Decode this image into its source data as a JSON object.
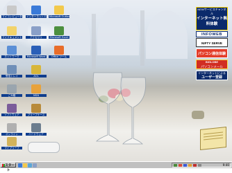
{
  "desktop": {
    "icons": [
      {
        "label": "マイコンピュータ",
        "color": "#c9c9c9"
      },
      {
        "label": "インターネットエクスプローラ",
        "color": "#3a7ad8"
      },
      {
        "label": "Microsoft Outlook",
        "color": "#f2c94c"
      },
      {
        "label": "マイドキュメント",
        "color": "#f2d36b"
      },
      {
        "label": "アクセサリ",
        "color": "#8aa0c8"
      },
      {
        "label": "Microsoft Excel",
        "color": "#4c8f3f"
      },
      {
        "label": "ネットワーク",
        "color": "#5b8fd6"
      },
      {
        "label": "Microsoft Word",
        "color": "#2a5fb8"
      },
      {
        "label": "Office ツール",
        "color": "#e86d2a"
      },
      {
        "label": "受信トレイ",
        "color": "#6f8fb8"
      },
      {
        "label": "AOL",
        "color": "#d8b63a"
      },
      {
        "label": "ごみ箱",
        "color": "#9aa5ae"
      },
      {
        "label": "MSN",
        "color": "#e8a23a"
      },
      {
        "label": "ソフトウェア",
        "color": "#7b5c9a"
      },
      {
        "label": "ブリーフケース",
        "color": "#b88a3a"
      },
      {
        "label": "オンライン",
        "color": "#b0b0b0"
      },
      {
        "label": "ハードウェア",
        "color": "#6c7d8e"
      },
      {
        "label": "マイブリーフ",
        "color": "#d3b35a"
      }
    ]
  },
  "banners": [
    {
      "text": "NEWサービスチャンネル",
      "sub": "インターネット無料体験",
      "bg": "#0b2a6b",
      "fg": "#ffffff",
      "accent": "#ffd800"
    },
    {
      "text": "INFOWEB",
      "sub": "",
      "bg": "#ffffff",
      "fg": "#0b2a6b",
      "accent": "#0b2a6b"
    },
    {
      "text": "NIFTY SERVE",
      "sub": "",
      "bg": "#ffffff",
      "fg": "#000000",
      "accent": "#333333"
    },
    {
      "text": "パソコン通信体験",
      "sub": "",
      "bg": "#e33d2a",
      "fg": "#ffffff",
      "accent": "#ffffff"
    },
    {
      "text": "BIGLOBE",
      "sub": "パソコンメール",
      "bg": "#d12d22",
      "fg": "#ffffff",
      "accent": "#ffe14a"
    },
    {
      "text": "インターネットによる",
      "sub": "ユーザー登録",
      "bg": "#0b2a6b",
      "fg": "#ffffff",
      "accent": "#ffffff"
    }
  ],
  "taskbar": {
    "start_label": "スタート",
    "clock": "9:40"
  }
}
